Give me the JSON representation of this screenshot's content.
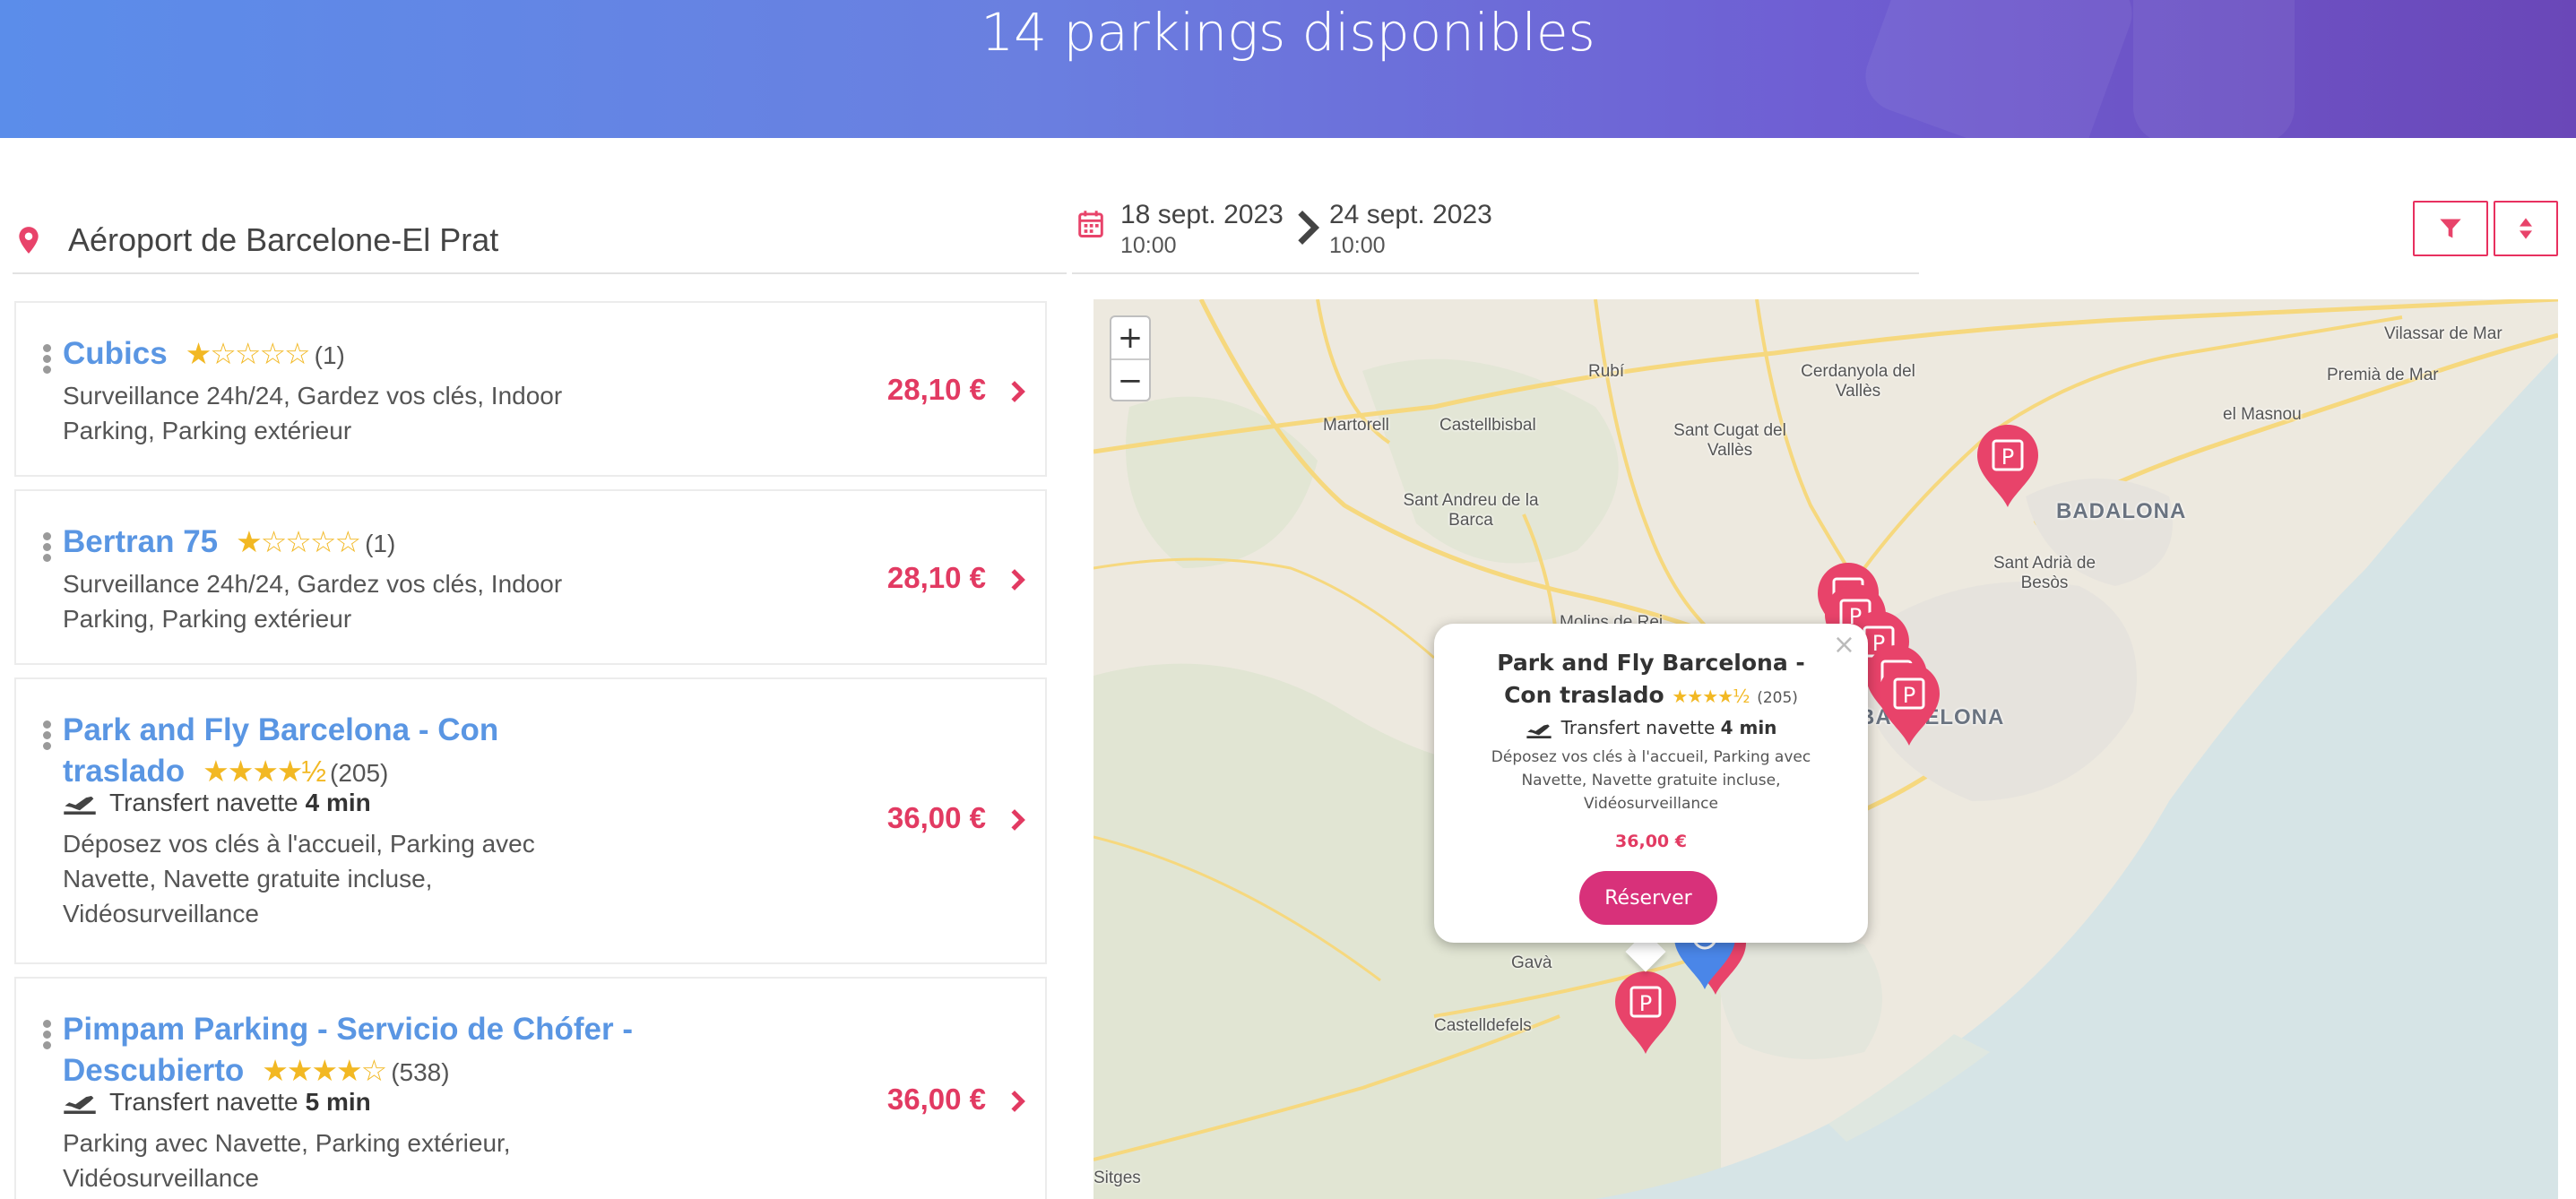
{
  "banner": {
    "title": "14 parkings disponibles"
  },
  "search": {
    "location": "Aéroport de Barcelone-El Prat",
    "start_date": "18 sept. 2023",
    "start_time": "10:00",
    "end_date": "24 sept. 2023",
    "end_time": "10:00"
  },
  "toolbar": {
    "filter_icon": "filter-icon",
    "sort_icon": "sort-icon"
  },
  "results": [
    {
      "name": "Cubics",
      "stars": "★☆☆☆☆",
      "rating_count": "(1)",
      "shuttle_label": "",
      "shuttle_time": "",
      "features": "Surveillance 24h/24, Gardez vos clés, Indoor Parking, Parking extérieur",
      "price": "28,10 €"
    },
    {
      "name": "Bertran 75",
      "stars": "★☆☆☆☆",
      "rating_count": "(1)",
      "shuttle_label": "",
      "shuttle_time": "",
      "features": "Surveillance 24h/24, Gardez vos clés, Indoor Parking, Parking extérieur",
      "price": "28,10 €"
    },
    {
      "name": "Park and Fly Barcelona - Con traslado",
      "stars": "★★★★½",
      "rating_count": "(205)",
      "shuttle_label": "Transfert navette",
      "shuttle_time": "4 min",
      "features": "Déposez vos clés à l'accueil, Parking avec Navette, Navette gratuite incluse, Vidéosurveillance",
      "price": "36,00 €"
    },
    {
      "name": "Pimpam Parking - Servicio de Chófer - Descubierto",
      "stars": "★★★★☆",
      "rating_count": "(538)",
      "shuttle_label": "Transfert navette",
      "shuttle_time": "5 min",
      "features": "Parking avec Navette, Parking extérieur, Vidéosurveillance",
      "price": "36,00 €"
    }
  ],
  "map": {
    "zoom_in": "+",
    "zoom_out": "−",
    "labels": {
      "vilassar": "Vilassar de Mar",
      "premia": "Premià de Mar",
      "masnou": "el Masnou",
      "rubi": "Rubí",
      "cerdanyola": "Cerdanyola del Vallès",
      "martorell": "Martorell",
      "castellbisbal": "Castellbisbal",
      "santcugat": "Sant Cugat del Vallès",
      "badalona": "BADALONA",
      "santandreu": "Sant Andreu de la Barca",
      "santadria": "Sant Adrià de Besòs",
      "molins": "Molins de Rei",
      "barcelona": "BARCELONA",
      "gava": "Gavà",
      "castelldefels": "Castelldefels",
      "sitges": "Sitges"
    },
    "popup": {
      "title": "Park and Fly Barcelona - Con traslado",
      "stars": "★★★★½",
      "rating_count": "(205)",
      "shuttle_label": "Transfert navette",
      "shuttle_time": "4 min",
      "features": "Déposez vos clés à l'accueil, Parking avec Navette, Navette gratuite incluse, Vidéosurveillance",
      "price": "36,00 €",
      "button": "Réserver",
      "close": "×"
    },
    "colors": {
      "marker": "#e8436a",
      "location_marker": "#4a86e8",
      "water": "#d6e4e6",
      "road": "#f6d87e"
    }
  }
}
